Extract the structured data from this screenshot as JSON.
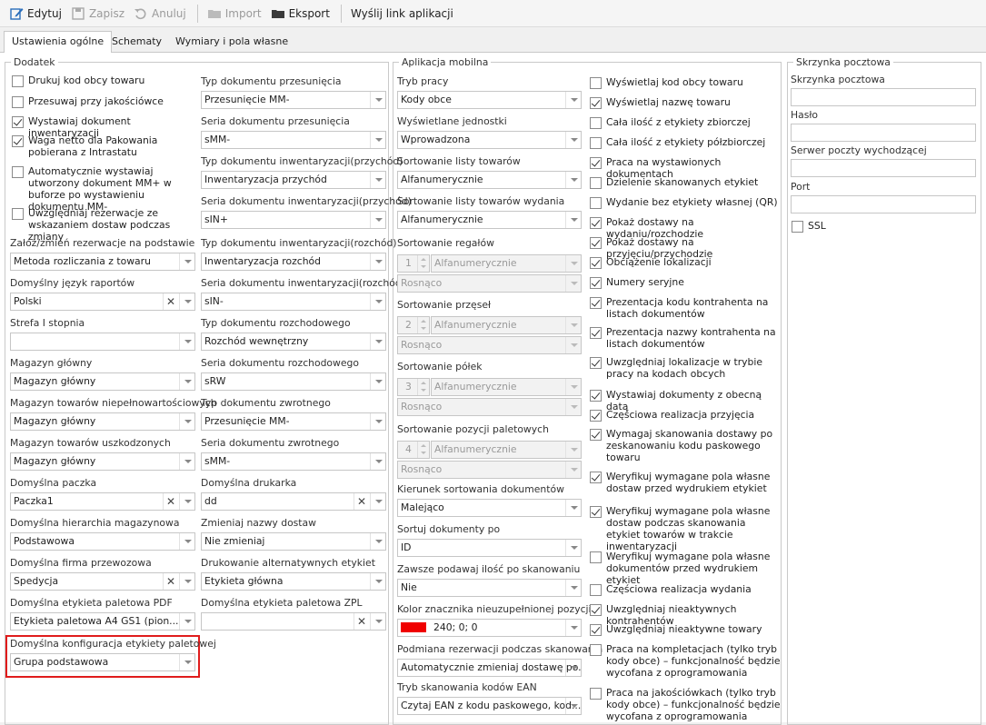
{
  "toolbar": {
    "edit": "Edytuj",
    "save": "Zapisz",
    "undo": "Anuluj",
    "import": "Import",
    "export": "Eksport",
    "send_link": "Wyślij link aplikacji"
  },
  "tabs": [
    "Ustawienia ogólne",
    "Schematy",
    "Wymiary i pola własne"
  ],
  "dodatek": {
    "title": "Dodatek",
    "checkboxes": [
      {
        "label": "Drukuj kod obcy towaru",
        "checked": false
      },
      {
        "label": "Przesuwaj przy jakościówce",
        "checked": false
      },
      {
        "label": "Wystawiaj dokument inwentaryzacji",
        "checked": true
      },
      {
        "label": "Waga netto dla Pakowania pobierana z Intrastatu",
        "checked": true
      },
      {
        "label": "Automatycznie wystawiaj utworzony dokument MM+ w buforze po wystawieniu dokumentu MM-",
        "checked": false
      },
      {
        "label": "Uwzględniaj rezerwacje ze wskazaniem dostaw podczas zmiany",
        "checked": false
      }
    ],
    "left_fields": [
      {
        "label": "Załóż/zmień rezerwacje na podstawie",
        "value": "Metoda rozliczania z towaru",
        "clear": false
      },
      {
        "label": "Domyślny język raportów",
        "value": "Polski",
        "clear": true
      },
      {
        "label": "Strefa I stopnia",
        "value": "",
        "clear": false
      },
      {
        "label": "Magazyn główny",
        "value": "Magazyn główny",
        "clear": false
      },
      {
        "label": "Magazyn towarów niepełnowartościowych",
        "value": "Magazyn główny",
        "clear": false
      },
      {
        "label": "Magazyn towarów uszkodzonych",
        "value": "Magazyn główny",
        "clear": false
      },
      {
        "label": "Domyślna paczka",
        "value": "Paczka1",
        "clear": true
      },
      {
        "label": "Domyślna hierarchia magazynowa",
        "value": "Podstawowa",
        "clear": false
      },
      {
        "label": "Domyślna firma przewozowa",
        "value": "Spedycja",
        "clear": true
      },
      {
        "label": "Domyślna etykieta paletowa PDF",
        "value": "Etykieta paletowa A4 GS1 (pion...",
        "clear": false
      },
      {
        "label": "Domyślna konfiguracja etykiety paletowej",
        "value": "Grupa podstawowa",
        "clear": false
      }
    ],
    "right_fields": [
      {
        "label": "Typ dokumentu przesunięcia",
        "value": "Przesunięcie MM-",
        "clear": false
      },
      {
        "label": "Seria dokumentu przesunięcia",
        "value": "sMM-",
        "clear": false
      },
      {
        "label": "Typ dokumentu inwentaryzacji(przychód)",
        "value": "Inwentaryzacja przychód",
        "clear": false
      },
      {
        "label": "Seria dokumentu inwentaryzacji(przychód)",
        "value": "sIN+",
        "clear": false
      },
      {
        "label": "Typ dokumentu inwentaryzacji(rozchód)",
        "value": "Inwentaryzacja rozchód",
        "clear": false
      },
      {
        "label": "Seria dokumentu inwentaryzacji(rozchód)",
        "value": "sIN-",
        "clear": false
      },
      {
        "label": "Typ dokumentu rozchodowego",
        "value": "Rozchód wewnętrzny",
        "clear": false
      },
      {
        "label": "Seria dokumentu rozchodowego",
        "value": "sRW",
        "clear": false
      },
      {
        "label": "Typ dokumentu zwrotnego",
        "value": "Przesunięcie MM-",
        "clear": false
      },
      {
        "label": "Seria dokumentu zwrotnego",
        "value": "sMM-",
        "clear": false
      },
      {
        "label": "Domyślna drukarka",
        "value": "dd",
        "clear": true
      },
      {
        "label": "Zmieniaj nazwy dostaw",
        "value": "Nie zmieniaj",
        "clear": false
      },
      {
        "label": "Drukowanie alternatywnych etykiet",
        "value": "Etykieta główna",
        "clear": false
      },
      {
        "label": "Domyślna etykieta paletowa ZPL",
        "value": "",
        "clear": true
      }
    ]
  },
  "mobile": {
    "title": "Aplikacja mobilna",
    "fields": [
      {
        "label": "Tryb pracy",
        "value": "Kody obce"
      },
      {
        "label": "Wyświetlane jednostki",
        "value": "Wprowadzona"
      },
      {
        "label": "Sortowanie listy towarów",
        "value": "Alfanumerycznie"
      },
      {
        "label": "Sortowanie listy towarów wydania",
        "value": "Alfanumerycznie"
      }
    ],
    "sort_groups": [
      {
        "label": "Sortowanie regałów",
        "num": "1",
        "value": "Alfanumerycznie",
        "order": "Rosnąco"
      },
      {
        "label": "Sortowanie przęseł",
        "num": "2",
        "value": "Alfanumerycznie",
        "order": "Rosnąco"
      },
      {
        "label": "Sortowanie półek",
        "num": "3",
        "value": "Alfanumerycznie",
        "order": "Rosnąco"
      },
      {
        "label": "Sortowanie pozycji paletowych",
        "num": "4",
        "value": "Alfanumerycznie",
        "order": "Rosnąco"
      }
    ],
    "fields2": [
      {
        "label": "Kierunek sortowania dokumentów",
        "value": "Malejąco"
      },
      {
        "label": "Sortuj dokumenty po",
        "value": "ID"
      },
      {
        "label": "Zawsze podawaj ilość po skanowaniu",
        "value": "Nie"
      }
    ],
    "color_label": "Kolor znacznika nieuzupełnionej pozycji",
    "color_value": "240; 0; 0",
    "color_hex": "#f00000",
    "fields3": [
      {
        "label": "Podmiana rezerwacji podczas skanowania",
        "value": "Automatycznie zmieniaj dostawę po..."
      },
      {
        "label": "Tryb skanowania kodów EAN",
        "value": "Czytaj EAN z kodu paskowego, kod..."
      }
    ],
    "checkboxes": [
      {
        "label": "Wyświetlaj kod obcy towaru",
        "checked": false
      },
      {
        "label": "Wyświetlaj nazwę towaru",
        "checked": true
      },
      {
        "label": "Cała ilość z etykiety zbiorczej",
        "checked": false
      },
      {
        "label": "Cała ilość z etykiety półzbiorczej",
        "checked": false
      },
      {
        "label": "Praca na wystawionych dokumentach",
        "checked": true
      },
      {
        "label": "Dzielenie skanowanych etykiet",
        "checked": false
      },
      {
        "label": "Wydanie bez etykiety własnej (QR)",
        "checked": false
      },
      {
        "label": "Pokaż dostawy na wydaniu/rozchodzie",
        "checked": true
      },
      {
        "label": "Pokaż dostawy na przyjęciu/przychodzie",
        "checked": true
      },
      {
        "label": "Obciążenie lokalizacji",
        "checked": true
      },
      {
        "label": "Numery seryjne",
        "checked": true
      },
      {
        "label": "Prezentacja kodu kontrahenta na listach dokumentów",
        "checked": true
      },
      {
        "label": "Prezentacja nazwy kontrahenta na listach dokumentów",
        "checked": true
      },
      {
        "label": "Uwzględniaj lokalizacje w trybie pracy na kodach obcych",
        "checked": true
      },
      {
        "label": "Wystawiaj dokumenty z obecną datą",
        "checked": true
      },
      {
        "label": "Częściowa realizacja przyjęcia",
        "checked": true
      },
      {
        "label": "Wymagaj skanowania dostawy po zeskanowaniu kodu paskowego towaru",
        "checked": true
      },
      {
        "label": "Weryfikuj wymagane pola własne dostaw przed wydrukiem etykiet",
        "checked": true
      },
      {
        "label": "Weryfikuj wymagane pola własne dostaw podczas skanowania etykiet towarów w trakcie inwentaryzacji",
        "checked": true
      },
      {
        "label": "Weryfikuj wymagane pola własne dokumentów przed wydrukiem etykiet",
        "checked": false
      },
      {
        "label": "Częściowa realizacja wydania",
        "checked": false
      },
      {
        "label": "Uwzględniaj nieaktywnych kontrahentów",
        "checked": true
      },
      {
        "label": "Uwzględniaj nieaktywne towary",
        "checked": true
      },
      {
        "label": "Praca na kompletacjach (tylko tryb kody obce) – funkcjonalność będzie wycofana z oprogramowania",
        "checked": false
      },
      {
        "label": "Praca na jakościówkach (tylko tryb kody obce) – funkcjonalność będzie wycofana z oprogramowania",
        "checked": false
      }
    ]
  },
  "mail": {
    "title": "Skrzynka pocztowa",
    "fields": [
      "Skrzynka pocztowa",
      "Hasło",
      "Serwer poczty wychodzącej",
      "Port"
    ],
    "ssl": "SSL"
  }
}
